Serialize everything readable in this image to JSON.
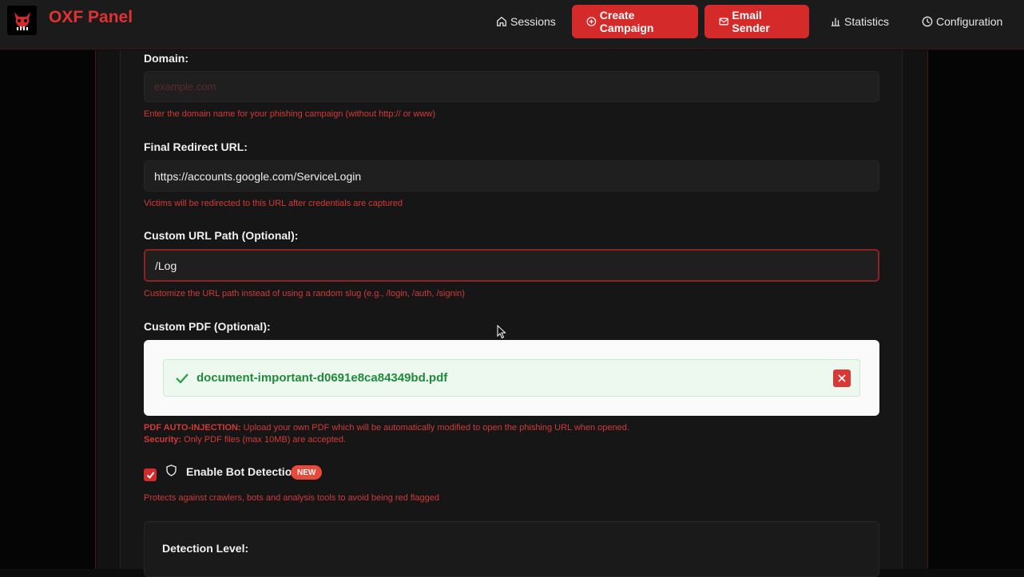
{
  "header": {
    "brand": "OXF Panel",
    "nav": [
      {
        "label": "Sessions",
        "icon": "home-icon",
        "active": false
      },
      {
        "label": "Create Campaign",
        "icon": "plus-circle-icon",
        "active": true
      },
      {
        "label": "Email Sender",
        "icon": "mail-icon",
        "active": true
      },
      {
        "label": "Statistics",
        "icon": "bar-chart-icon",
        "active": false
      },
      {
        "label": "Configuration",
        "icon": "clock-icon",
        "active": false
      }
    ]
  },
  "form": {
    "domain": {
      "label": "Domain:",
      "placeholder": "example.com",
      "hint": "Enter the domain name for your phishing campaign (without http:// or www)"
    },
    "redirect": {
      "label": "Final Redirect URL:",
      "value": "https://accounts.google.com/ServiceLogin",
      "hint": "Victims will be redirected to this URL after credentials are captured"
    },
    "path": {
      "label": "Custom URL Path (Optional):",
      "value": "/Log",
      "hint": "Customize the URL path instead of using a random slug (e.g., /login, /auth, /signin)"
    },
    "pdf": {
      "label": "Custom PDF (Optional):",
      "filename": "document-important-d0691e8ca84349bd.pdf",
      "note1_strong": "PDF AUTO-INJECTION:",
      "note1": " Upload your own PDF which will be automatically modified to open the phishing URL when opened.",
      "note2_strong": "Security:",
      "note2": " Only PDF files (max 10MB) are accepted."
    },
    "bot": {
      "label": "Enable Bot Detection",
      "badge": "NEW",
      "checked": true,
      "hint": "Protects against crawlers, bots and analysis tools to avoid being red flagged"
    },
    "detection": {
      "label": "Detection Level:"
    }
  },
  "colors": {
    "accent": "#d42a2a",
    "success": "#1f8a3b",
    "background": "#0d0d0d"
  }
}
